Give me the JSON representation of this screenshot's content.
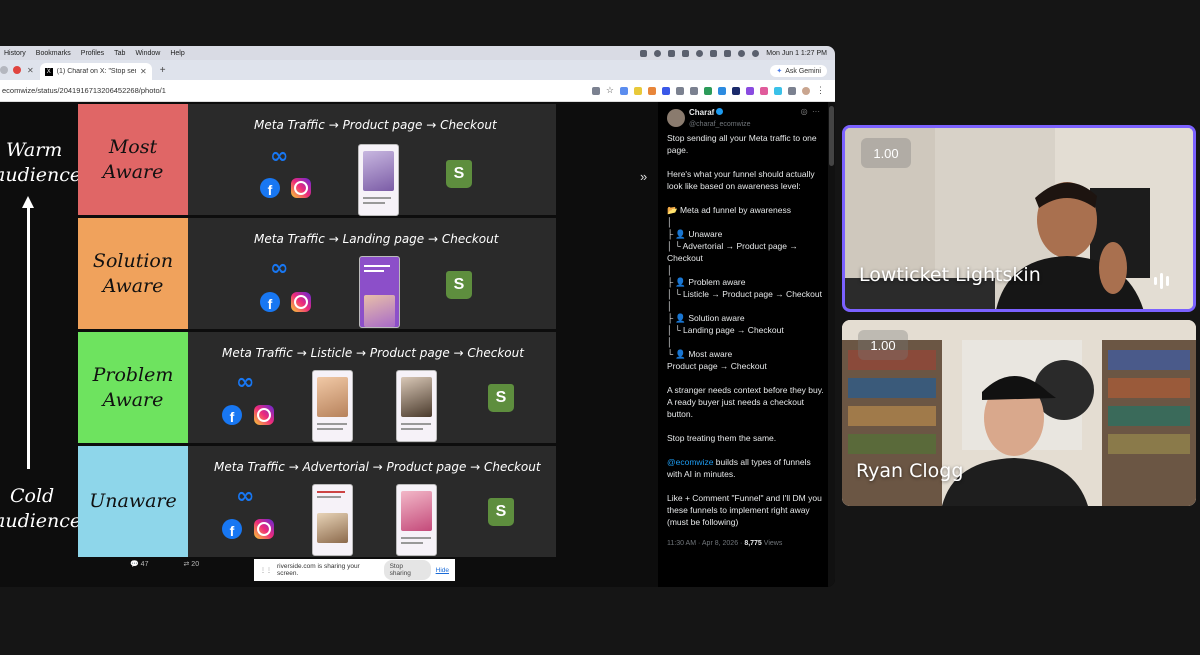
{
  "menubar": {
    "items": [
      "History",
      "Bookmarks",
      "Profiles",
      "Tab",
      "Window",
      "Help"
    ],
    "datetime": "Mon Jun 1  1:27 PM"
  },
  "browser": {
    "tab_title": "(1) Charaf on X: \"Stop sendin",
    "new_tab": "+",
    "url": "ecomwize/status/2041916713206452268/photo/1",
    "ask_gemini": "Ask Gemini"
  },
  "slide": {
    "top_label": "Warm\naudience",
    "bottom_label": "Cold\naudience",
    "rows": [
      {
        "stage": "Most\nAware",
        "color": "#e06666",
        "flow": "Meta Traffic → Product page → Checkout"
      },
      {
        "stage": "Solution\nAware",
        "color": "#f0a25c",
        "flow": "Meta Traffic → Landing page → Checkout"
      },
      {
        "stage": "Problem\nAware",
        "color": "#6ee35f",
        "flow": "Meta Traffic → Listicle → Product page → Checkout"
      },
      {
        "stage": "Unaware",
        "color": "#8ed6ea",
        "flow": "Meta Traffic → Advertorial → Product page → Checkout"
      }
    ]
  },
  "x_actions": {
    "replies": "47",
    "reposts": "20"
  },
  "share_banner": {
    "text": "riverside.com is sharing your screen.",
    "stop": "Stop sharing",
    "hide": "Hide"
  },
  "tweet": {
    "name": "Charaf",
    "handle": "@charaf_ecomwize",
    "body_1": "Stop sending all your Meta traffic to one page.\n\nHere's what your funnel should actually look like based on awareness level:\n\n📂 Meta ad funnel by awareness\n│\n├ 👤 Unaware\n│  └ Advertorial → Product page → Checkout\n│\n├ 👤 Problem aware\n│  └ Listicle → Product page → Checkout\n│\n├ 👤 Solution aware\n│  └ Landing page → Checkout\n│\n└ 👤 Most aware\n   Product page → Checkout\n\nA stranger needs context before they buy.\nA ready buyer just needs a checkout button.\n\nStop treating them the same.\n\n",
    "mention": "@ecomwize",
    "body_2": " builds all types of funnels with AI in minutes.\n\nLike + Comment \"Funnel\" and I'll DM you these funnels to implement right away (must be following)",
    "time": "11:30 AM · Apr 8, 2026 · ",
    "views": "8,775",
    "views_label": " Views"
  },
  "participants": [
    {
      "name": "Lowticket Lightskin",
      "speed": "1.00",
      "speaking": true
    },
    {
      "name": "Ryan Clogg",
      "speed": "1.00",
      "speaking": false
    }
  ]
}
